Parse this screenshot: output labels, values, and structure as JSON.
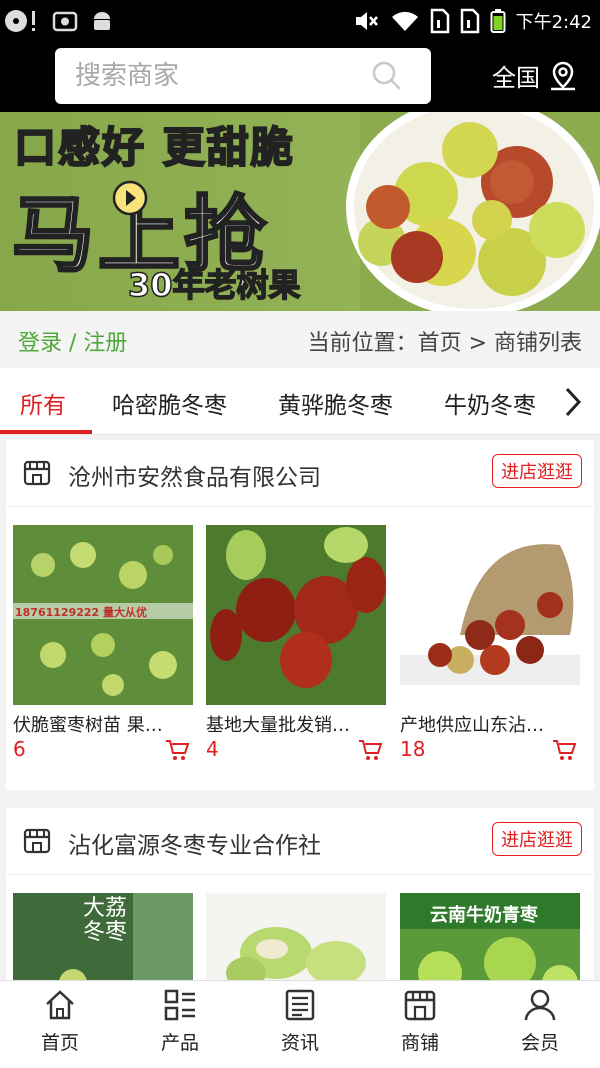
{
  "status_bar": {
    "time": "下午2:42",
    "icons": [
      "disc-alert-icon",
      "screenshot-icon",
      "android-icon",
      "mute-icon",
      "wifi-icon",
      "sim1-icon",
      "sim2-icon",
      "battery-icon"
    ]
  },
  "header": {
    "search_placeholder": "搜索商家",
    "region_label": "全国"
  },
  "banner": {
    "line1": "口感好 更甜脆",
    "line2": "马上抢",
    "line3": "30年老树果"
  },
  "login_row": {
    "login_label": "登录 / 注册",
    "location": "当前位置：首页 > 商铺列表"
  },
  "tabs": [
    {
      "label": "所有",
      "active": true
    },
    {
      "label": "哈密脆冬枣",
      "active": false
    },
    {
      "label": "黄骅脆冬枣",
      "active": false
    },
    {
      "label": "牛奶冬枣",
      "active": false
    }
  ],
  "shops": [
    {
      "name": "沧州市安然食品有限公司",
      "enter_label": "进店逛逛",
      "products": [
        {
          "name": "伏脆蜜枣树苗 果…",
          "price": "6",
          "image_text": "18761129222 量大从优"
        },
        {
          "name": "基地大量批发销…",
          "price": "4"
        },
        {
          "name": "产地供应山东沾…",
          "price": "18"
        }
      ]
    },
    {
      "name": "沾化富源冬枣专业合作社",
      "enter_label": "进店逛逛",
      "products": [
        {
          "name": "",
          "price": "",
          "image_text": "大荔冬枣"
        },
        {
          "name": "",
          "price": ""
        },
        {
          "name": "",
          "price": "",
          "image_text": "云南牛奶青枣"
        }
      ]
    }
  ],
  "bottom_nav": [
    {
      "label": "首页",
      "icon": "home-icon"
    },
    {
      "label": "产品",
      "icon": "product-list-icon"
    },
    {
      "label": "资讯",
      "icon": "news-icon"
    },
    {
      "label": "商铺",
      "icon": "shop-icon"
    },
    {
      "label": "会员",
      "icon": "member-icon"
    }
  ],
  "colors": {
    "accent_red": "#e02020",
    "login_green": "#4fa83a",
    "banner_green": "#8cab4e"
  }
}
